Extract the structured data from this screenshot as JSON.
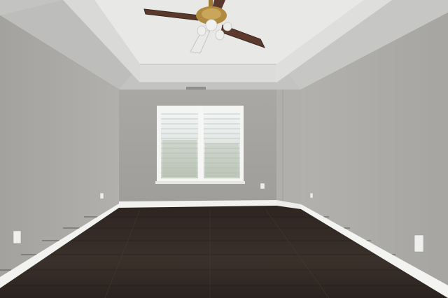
{
  "scene": {
    "subject": "empty room",
    "colors": {
      "wall_left": "#a8a7a3",
      "wall_back": "#a2a19d",
      "wall_right": "#a9a8a4",
      "ceiling_outer": "#c8c8c6",
      "ceiling_tray": "#e6e6e4",
      "trim": "#f2f2f0",
      "floor_dark": "#2b231f",
      "floor_mid": "#3a302a",
      "fan_blade": "#5b3a2e",
      "fan_brass": "#b08a3e",
      "window_light": "#e9ecec"
    }
  }
}
